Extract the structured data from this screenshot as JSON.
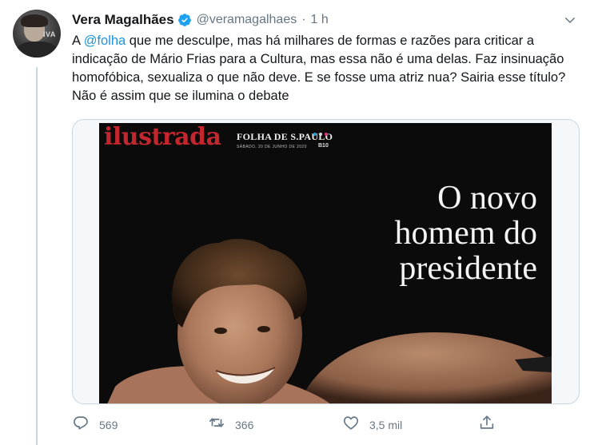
{
  "tweet": {
    "author_name": "Vera Magalhães",
    "handle": "@veramagalhaes",
    "separator": "·",
    "time": "1 h",
    "avatar_text": "IVA",
    "text_prefix": "A ",
    "mention": "@folha",
    "text_body": " que me desculpe, mas há milhares de formas e razões para criticar a indicação de Mário Frias para a Cultura, mas essa não é uma delas. Faz insinuação homofóbica, sexualiza o que não deve. E se fosse uma atriz nua? Sairia esse título? Não é assim que se ilumina o debate"
  },
  "media": {
    "brand": "ilustrada",
    "paper": "FOLHA DE S.PAULO",
    "date": "SÁBADO, 20 DE JUNHO DE 2020",
    "code": "B10",
    "headline_lines": [
      "O novo",
      "homem do",
      "presidente"
    ]
  },
  "actions": {
    "reply_count": "569",
    "retweet_count": "366",
    "like_count": "3,5 mil"
  },
  "icons": {
    "verified": "verified-badge-icon",
    "menu": "chevron-down-icon",
    "reply": "reply-icon",
    "retweet": "retweet-icon",
    "like": "heart-icon",
    "share": "share-icon"
  },
  "colors": {
    "link": "#1b95e0",
    "muted": "#657786",
    "verified": "#1da1f2",
    "brand_red": "#c4262e"
  }
}
